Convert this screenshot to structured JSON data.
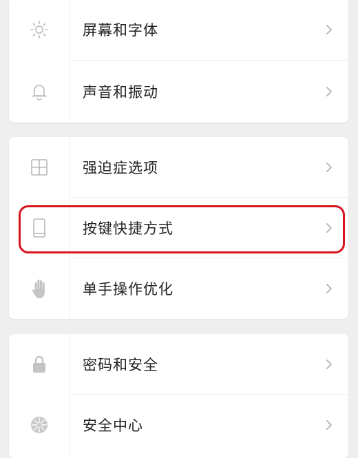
{
  "groups": [
    {
      "items": [
        {
          "label": "屏幕和字体",
          "icon": "brightness-icon"
        },
        {
          "label": "声音和振动",
          "icon": "bell-icon"
        }
      ]
    },
    {
      "items": [
        {
          "label": "强迫症选项",
          "icon": "grid-icon"
        },
        {
          "label": "按键快捷方式",
          "icon": "phone-icon",
          "highlighted": true
        },
        {
          "label": "单手操作优化",
          "icon": "hand-icon"
        }
      ]
    },
    {
      "items": [
        {
          "label": "密码和安全",
          "icon": "lock-icon"
        },
        {
          "label": "安全中心",
          "icon": "shield-icon"
        }
      ]
    }
  ],
  "colors": {
    "background": "#efefef",
    "card": "#ffffff",
    "text": "#222222",
    "icon": "#b8b8b8",
    "chevron": "#b0b0b0",
    "highlight": "#d8141e"
  }
}
